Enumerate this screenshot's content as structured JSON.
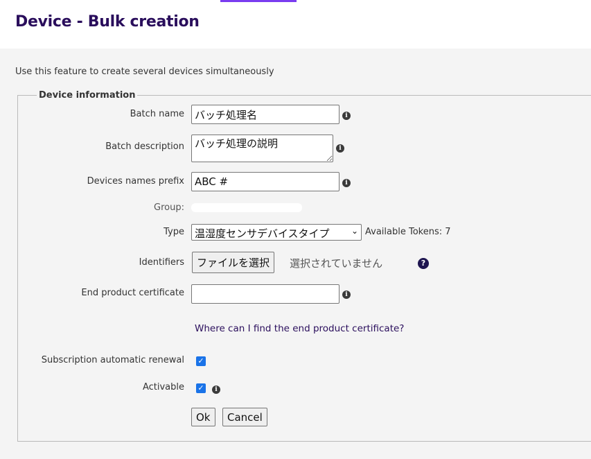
{
  "header": {
    "title": "Device - Bulk creation"
  },
  "intro": "Use this feature to create several devices simultaneously",
  "fieldset": {
    "legend": "Device information",
    "batch_name": {
      "label": "Batch name",
      "value": "バッチ処理名"
    },
    "batch_description": {
      "label": "Batch description",
      "value": "バッチ処理の説明"
    },
    "prefix": {
      "label": "Devices names prefix",
      "value": "ABC #"
    },
    "group": {
      "label": "Group:"
    },
    "type": {
      "label": "Type",
      "selected": "温湿度センサデバイスタイプ",
      "tokens": "Available Tokens: 7"
    },
    "identifiers": {
      "label": "Identifiers",
      "button": "ファイルを選択",
      "no_file": "選択されていません"
    },
    "end_cert": {
      "label": "End product certificate",
      "value": ""
    },
    "cert_link": "Where can I find the end product certificate?",
    "renewal": {
      "label": "Subscription automatic renewal",
      "checked": true
    },
    "activable": {
      "label": "Activable",
      "checked": true
    },
    "ok": "Ok",
    "cancel": "Cancel"
  },
  "icons": {
    "info": "info-icon",
    "help": "question-circle-icon",
    "chevron": "chevron-down-icon",
    "check": "checkmark-icon"
  },
  "colors": {
    "title": "#2a0e5c",
    "accent": "#7a3cf0",
    "checkbox": "#1a73e8"
  }
}
